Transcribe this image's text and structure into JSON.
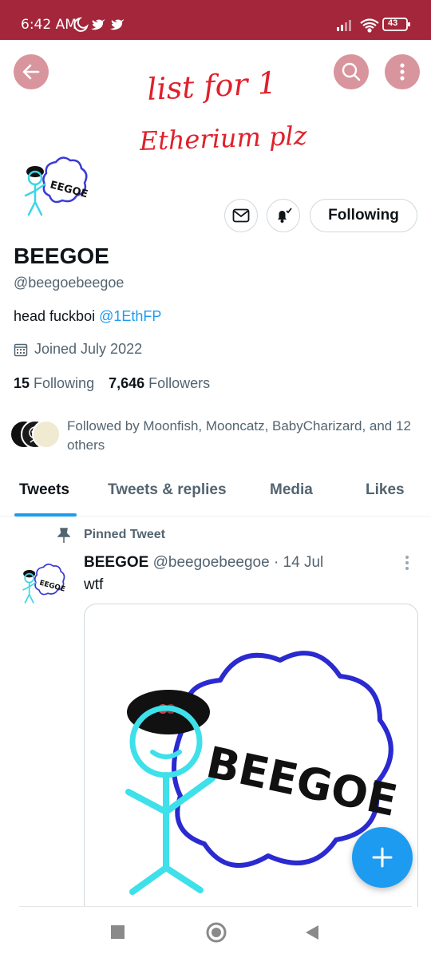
{
  "status_bar": {
    "time": "6:42 AM",
    "battery": "43",
    "bg_color": "#a3263a"
  },
  "header": {
    "back_icon": "arrow-left-icon",
    "search_icon": "search-icon",
    "more_icon": "more-vertical-icon",
    "handwritten_note_line1": "list for 1",
    "handwritten_note_line2": "Etherium plz"
  },
  "profile": {
    "display_name": "BEEGOE",
    "handle": "@beegoebeegoe",
    "bio_text": "head fuckboi ",
    "bio_link": "@1EthFP",
    "joined": "Joined July 2022",
    "following_count": "15",
    "following_label": "Following",
    "followers_count": "7,646",
    "followers_label": "Followers",
    "followed_by": "Followed by Moonfish, Mooncatz, BabyCharizard, and 12 others",
    "following_button": "Following",
    "accent_color": "#1d9bf0"
  },
  "tabs": [
    {
      "label": "Tweets",
      "active": true
    },
    {
      "label": "Tweets & replies",
      "active": false
    },
    {
      "label": "Media",
      "active": false
    },
    {
      "label": "Likes",
      "active": false
    }
  ],
  "tweet": {
    "pinned_label": "Pinned Tweet",
    "author_name": "BEEGOE",
    "author_handle": "@beegoebeegoe",
    "dot": " · ",
    "date": "14 Jul",
    "text": "wtf",
    "drawing_text": "BEEGOE"
  },
  "fab": {
    "icon": "compose-plus-icon"
  },
  "nav": {
    "recents_icon": "square-icon",
    "home_icon": "circle-icon",
    "back_icon": "triangle-back-icon"
  }
}
